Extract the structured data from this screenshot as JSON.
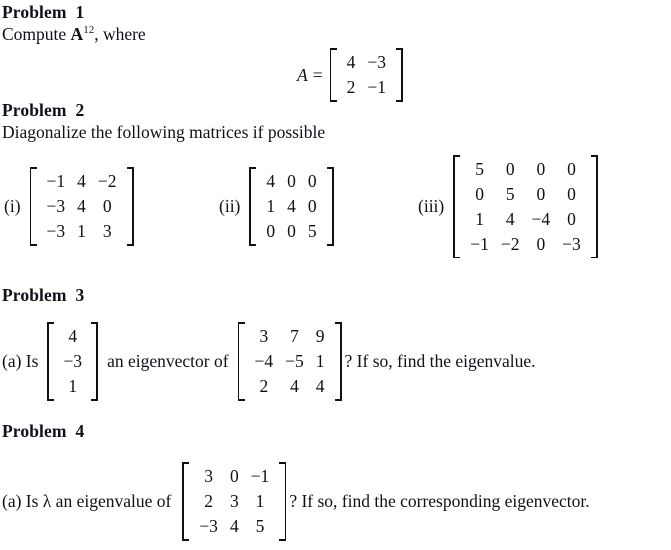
{
  "document": {
    "type": "math-homework-worksheet",
    "subject": "linear-algebra",
    "background_color": "#ffffff",
    "text_color": "#101018"
  },
  "problems": [
    {
      "heading": "Problem  1",
      "prompt_prefix": "Compute ",
      "prompt_var": "A",
      "prompt_exponent": "12",
      "prompt_suffix": ", where",
      "equation": {
        "lhs": "A",
        "relation": "=",
        "matrix": {
          "rows": 2,
          "cols": 2,
          "values": [
            [
              "4",
              "−3"
            ],
            [
              "2",
              "−1"
            ]
          ]
        }
      }
    },
    {
      "heading": "Problem  2",
      "prompt": "Diagonalize the following matrices if possible",
      "items": [
        {
          "label": "(i)",
          "matrix": {
            "rows": 3,
            "cols": 3,
            "values": [
              [
                "−1",
                "4",
                "−2"
              ],
              [
                "−3",
                "4",
                "0"
              ],
              [
                "−3",
                "1",
                "3"
              ]
            ]
          }
        },
        {
          "label": "(ii)",
          "matrix": {
            "rows": 3,
            "cols": 3,
            "values": [
              [
                "4",
                "0",
                "0"
              ],
              [
                "1",
                "4",
                "0"
              ],
              [
                "0",
                "0",
                "5"
              ]
            ]
          }
        },
        {
          "label": "(iii)",
          "matrix": {
            "rows": 4,
            "cols": 4,
            "values": [
              [
                "5",
                "0",
                "0",
                "0"
              ],
              [
                "0",
                "5",
                "0",
                "0"
              ],
              [
                "1",
                "4",
                "−4",
                "0"
              ],
              [
                "−1",
                "−2",
                "0",
                "−3"
              ]
            ]
          }
        }
      ]
    },
    {
      "heading": "Problem  3",
      "part_label": "(a) Is",
      "vector": {
        "rows": 3,
        "cols": 1,
        "values": [
          [
            "4"
          ],
          [
            "−3"
          ],
          [
            "1"
          ]
        ]
      },
      "mid_text": "an eigenvector of",
      "matrix": {
        "rows": 3,
        "cols": 3,
        "values": [
          [
            "3",
            "7",
            "9"
          ],
          [
            "−4",
            "−5",
            "1"
          ],
          [
            "2",
            "4",
            "4"
          ]
        ]
      },
      "tail_text": "? If so, find the eigenvalue."
    },
    {
      "heading": "Problem  4",
      "part_label": "(a) Is λ an eigenvalue of",
      "matrix": {
        "rows": 3,
        "cols": 3,
        "values": [
          [
            "3",
            "0",
            "−1"
          ],
          [
            "2",
            "3",
            "1"
          ],
          [
            "−3",
            "4",
            "5"
          ]
        ]
      },
      "tail_text": "? If so, find the corresponding eigenvector."
    }
  ]
}
